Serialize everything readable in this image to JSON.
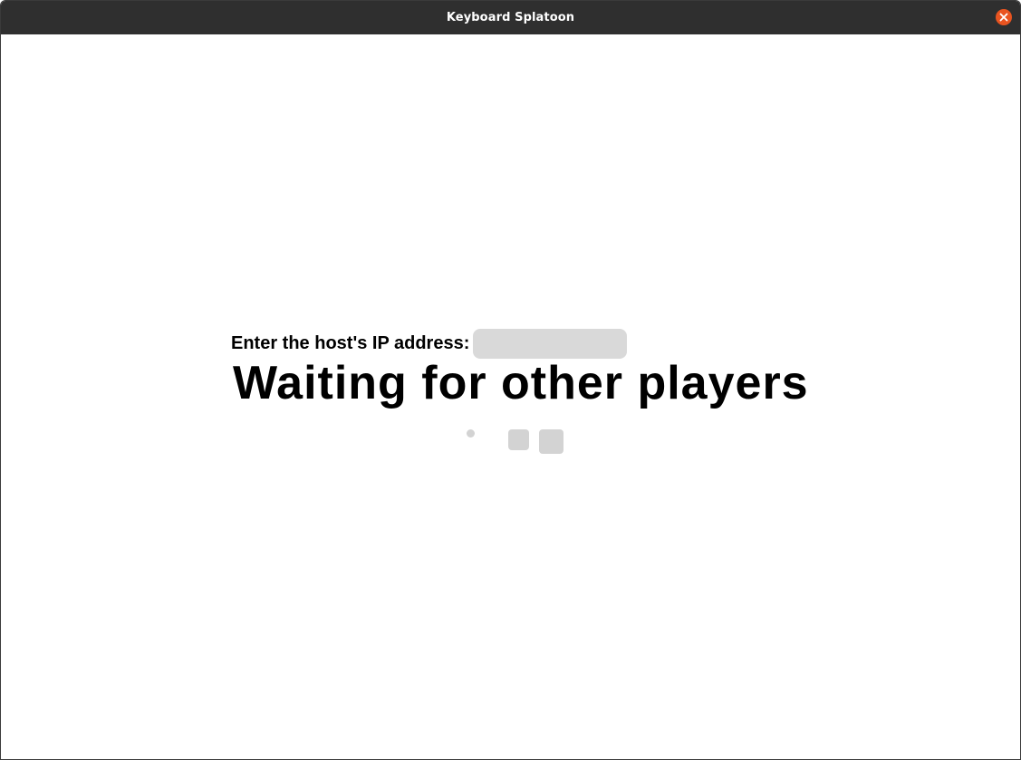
{
  "window": {
    "title": "Keyboard Splatoon",
    "close_icon": "close-icon",
    "accent_color": "#e95420"
  },
  "main": {
    "ip_label": "Enter the host's IP address:",
    "ip_input": {
      "value": "",
      "placeholder": ""
    },
    "waiting_text": "Waiting for other players",
    "loading_indicators": [
      "dot",
      "small-square",
      "large-square"
    ]
  }
}
